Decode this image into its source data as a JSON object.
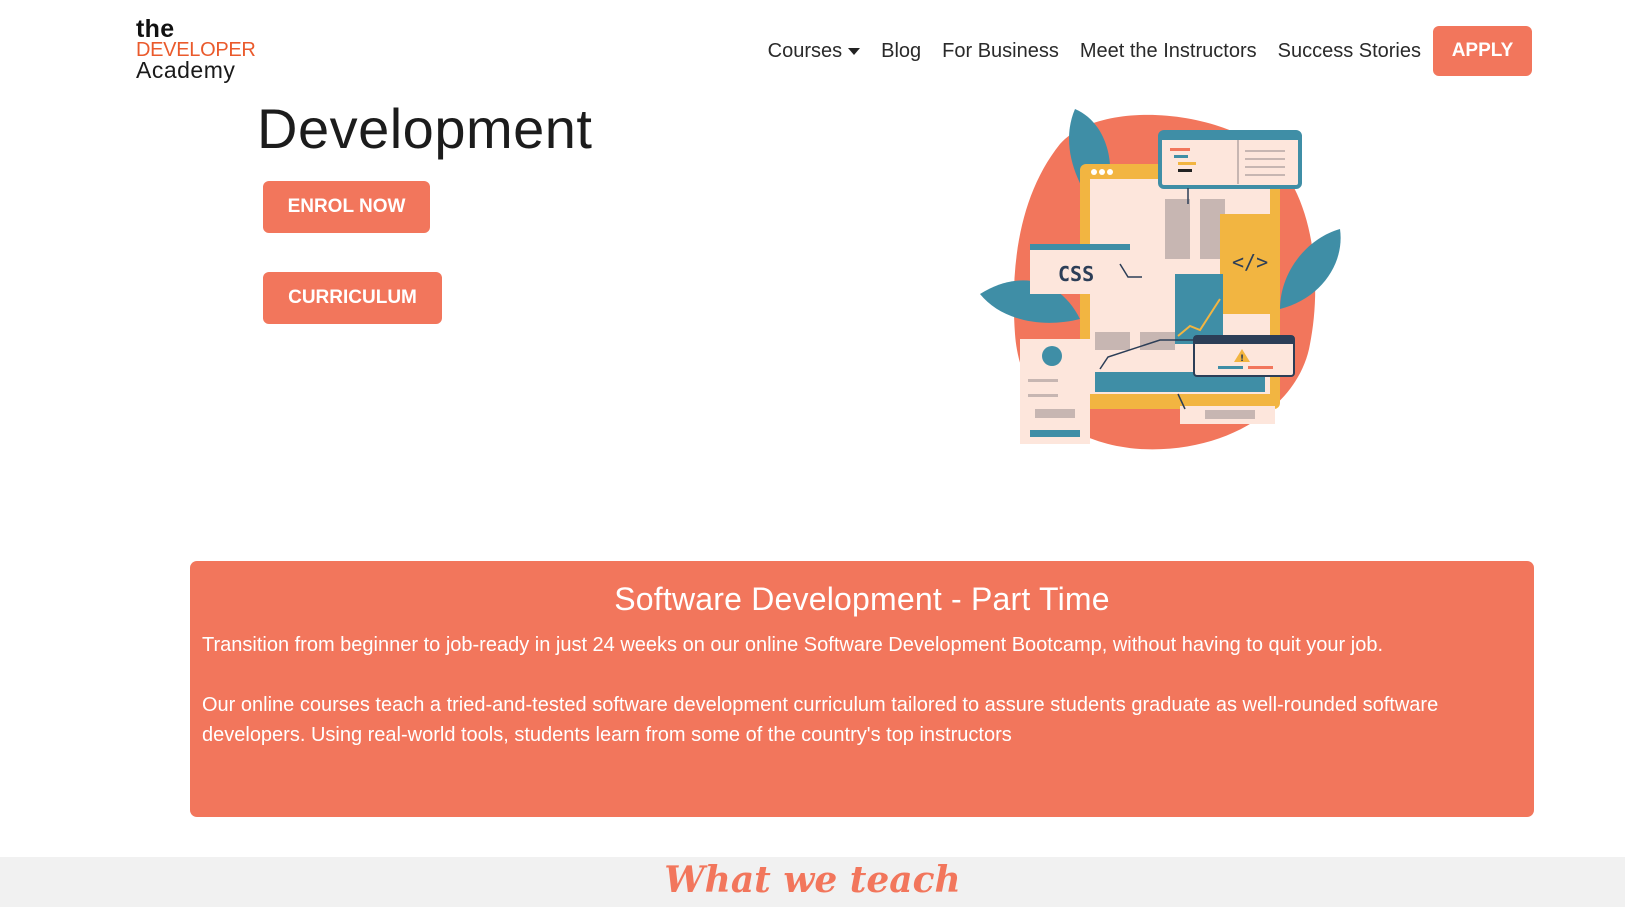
{
  "logo": {
    "line1": "the",
    "line2": "DEVELOPER",
    "line3": "Academy"
  },
  "nav": {
    "courses": "Courses",
    "blog": "Blog",
    "business": "For Business",
    "instructors": "Meet the Instructors",
    "stories": "Success Stories",
    "apply": "APPLY"
  },
  "hero": {
    "title": "Development",
    "enrol_label": "ENROL NOW",
    "curriculum_label": "CURRICULUM",
    "illustration": {
      "css_tag": "CSS",
      "code_tag": "</>",
      "warning_glyph": "!"
    }
  },
  "course": {
    "title": "Software Development - Part Time",
    "para1": "Transition from beginner to job-ready in just 24 weeks on our online Software Development Bootcamp, without having to quit your job.",
    "para2": "Our online courses teach a tried-and-tested software development curriculum tailored to assure students graduate as well-rounded software developers. Using real-world tools, students learn from some of the country's top instructors"
  },
  "section": {
    "what_we_teach": "What we teach"
  },
  "colors": {
    "accent": "#f2765c",
    "logo_orange": "#ea5a2c",
    "teal": "#3f8ea6",
    "yellow": "#f2b541",
    "cream": "#fde6dc"
  }
}
